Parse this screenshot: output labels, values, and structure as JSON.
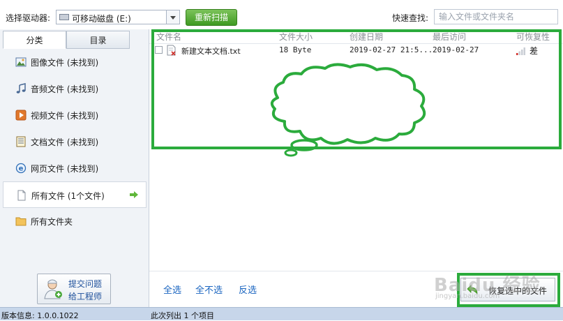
{
  "toolbar": {
    "drive_label": "选择驱动器:",
    "drive_value": "可移动磁盘 (E:)",
    "rescan_label": "重新扫描",
    "search_label": "快速查找:",
    "search_placeholder": "输入文件或文件夹名"
  },
  "sidebar": {
    "tabs": [
      "分类",
      "目录"
    ],
    "items": [
      {
        "label": "图像文件 (未找到)",
        "icon": "image-file-icon"
      },
      {
        "label": "音频文件 (未找到)",
        "icon": "music-note-icon"
      },
      {
        "label": "视频文件 (未找到)",
        "icon": "video-file-icon"
      },
      {
        "label": "文档文件 (未找到)",
        "icon": "document-file-icon"
      },
      {
        "label": "网页文件 (未找到)",
        "icon": "web-file-icon"
      },
      {
        "label": "所有文件 (1个文件)",
        "icon": "blank-file-icon"
      },
      {
        "label": "所有文件夹",
        "icon": "folder-icon"
      }
    ],
    "engineer_line1": "提交问题",
    "engineer_line2": "给工程师"
  },
  "table": {
    "columns": [
      "文件名",
      "文件大小",
      "创建日期",
      "最后访问",
      "可恢复性"
    ],
    "rows": [
      {
        "name": "新建文本文档.txt",
        "size": "18 Byte",
        "created": "2019-02-27 21:5...",
        "accessed": "2019-02-27",
        "recoverability": "差"
      }
    ]
  },
  "actions": {
    "select_all": "全选",
    "select_none": "全不选",
    "invert": "反选",
    "recover": "恢复选中的文件"
  },
  "status": {
    "version": "版本信息: 1.0.0.1022",
    "count": "此次列出 1 个项目"
  },
  "watermark": {
    "brand": "Baidu 经验",
    "url": "jingyan.baidu.com"
  },
  "colors": {
    "accent_green": "#2bab3c",
    "link_blue": "#1a65c0",
    "status_bar": "#c7d6ea"
  }
}
